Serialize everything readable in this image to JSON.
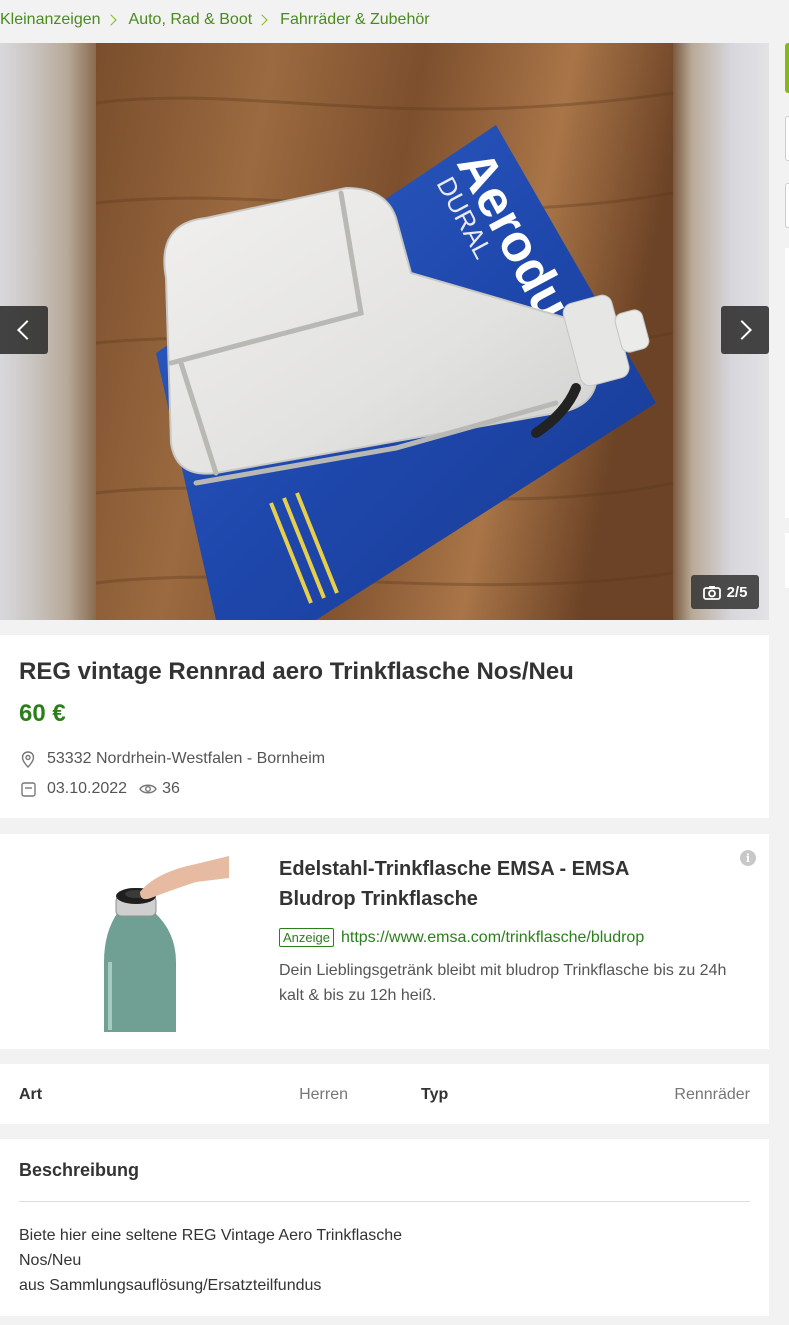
{
  "breadcrumb": {
    "items": [
      "Kleinanzeigen",
      "Auto, Rad & Boot",
      "Fahrräder & Zubehör"
    ]
  },
  "gallery": {
    "counter": "2/5",
    "current_image": 2,
    "total_images": 5
  },
  "listing": {
    "title": "REG vintage Rennrad aero Trinkflasche Nos/Neu",
    "price": "60 €",
    "location": "53332 Nordrhein-Westfalen - Bornheim",
    "date": "03.10.2022",
    "views": "36"
  },
  "ad": {
    "title": "Edelstahl-Trinkflasche EMSA - EMSA Bludrop Trinkflasche",
    "badge": "Anzeige",
    "url": "https://www.emsa.com/trinkflasche/bludrop",
    "description": "Dein Lieblingsgetränk bleibt mit bludrop Trinkflasche bis zu 24h kalt & bis zu 12h heiß.",
    "info_icon": "i"
  },
  "attributes": [
    {
      "label": "Art",
      "value": "Herren"
    },
    {
      "label": "Typ",
      "value": "Rennräder"
    }
  ],
  "description": {
    "heading": "Beschreibung",
    "lines": [
      "Biete hier eine seltene REG Vintage Aero Trinkflasche",
      "Nos/Neu",
      "aus Sammlungsauflösung/Ersatzteilfundus"
    ]
  },
  "colors": {
    "accent_green": "#86b817",
    "link_green": "#2b7f1a",
    "background": "#f2f2f2"
  }
}
